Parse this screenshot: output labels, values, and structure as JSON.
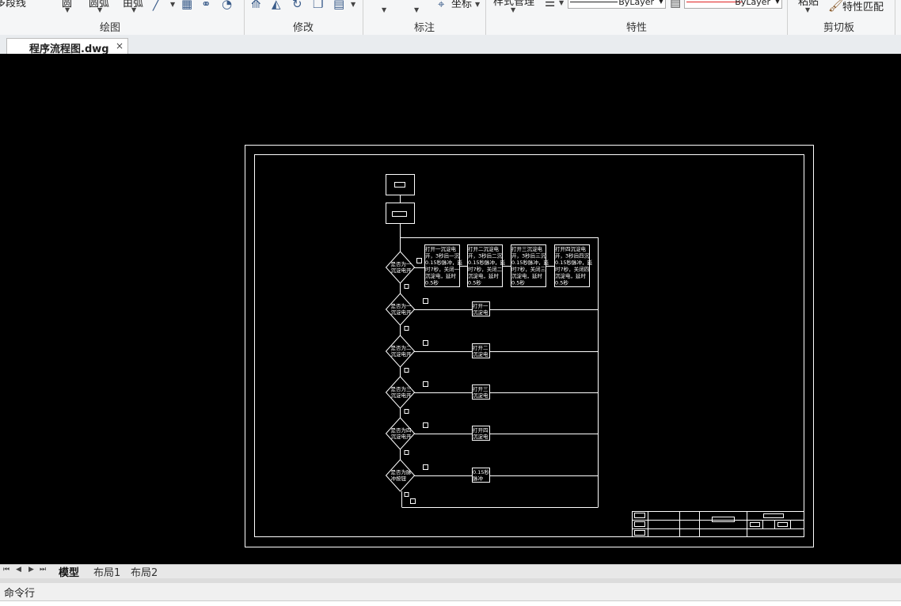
{
  "ribbon": {
    "draw_items": [
      "多段线",
      "圆",
      "圆弧",
      "由弧"
    ],
    "groups": [
      "绘图",
      "修改",
      "标注",
      "特性",
      "剪切板"
    ],
    "coord_label": "坐标",
    "style_label": "样式管理",
    "linetype": "ByLayer",
    "lineweight": "ByLayer",
    "paste_label": "粘贴",
    "match_props": "特性匹配"
  },
  "document_tab": {
    "name": "程序流程图.dwg",
    "close": "×"
  },
  "drawing": {
    "loop_text": [
      "打开一沉淀电",
      "开，3秒后一沉",
      "0.15秒脉冲，延",
      "时7秒，关闭一",
      "沉淀电，延时",
      "0.5秒"
    ],
    "process_boxes": [
      [
        "打开一沉淀电",
        "开，3秒后一沉",
        "0.15秒脉冲，延",
        "时7秒，关闭一",
        "沉淀电，延时",
        "0.5秒"
      ],
      [
        "打开二沉淀电",
        "开，3秒后二沉",
        "0.15秒脉冲，延",
        "时7秒，关闭二",
        "沉淀电，延时",
        "0.5秒"
      ],
      [
        "打开三沉淀电",
        "开，3秒后三沉",
        "0.15秒脉冲，延",
        "时7秒，关闭三",
        "沉淀电，延时",
        "0.5秒"
      ],
      [
        "打开四沉淀电",
        "开，3秒后四沉",
        "0.15秒脉冲，延",
        "时7秒，关闭四",
        "沉淀电，延时",
        "0.5秒"
      ]
    ],
    "decisions": [
      [
        "是否为一",
        "沉淀电开"
      ],
      [
        "是否为一",
        "沉淀电开"
      ],
      [
        "是否为二",
        "沉淀电开"
      ],
      [
        "是否为三",
        "沉淀电开"
      ],
      [
        "是否为四",
        "沉淀电开"
      ],
      [
        "是否为脉",
        "冲按钮"
      ]
    ],
    "branch_boxes": [
      [
        "打开一",
        "沉淀电"
      ],
      [
        "打开二",
        "沉淀电"
      ],
      [
        "打开三",
        "沉淀电"
      ],
      [
        "打开四",
        "沉淀电"
      ],
      [
        "0.15秒",
        "脉冲"
      ]
    ]
  },
  "layout_tabs": {
    "nav": [
      "⏮",
      "◀",
      "▶",
      "⏭"
    ],
    "tabs": [
      "模型",
      "布局1",
      "布局2"
    ],
    "active": "模型"
  },
  "command": {
    "label": "命令行"
  },
  "colors": {
    "canvas": "#000000",
    "line": "#ffffff",
    "accent": "#e02020"
  }
}
